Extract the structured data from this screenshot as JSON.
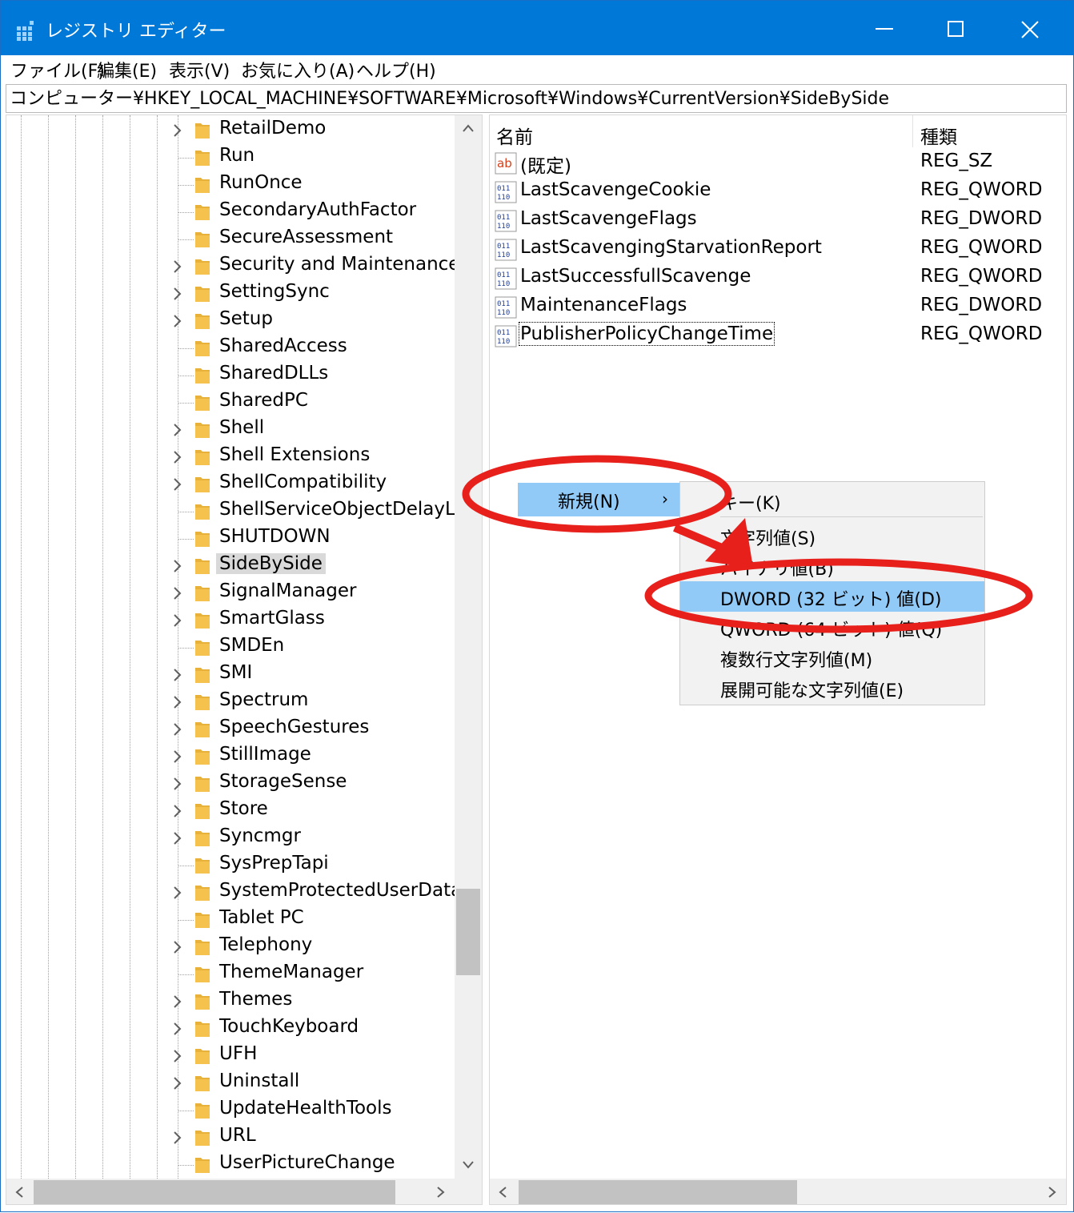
{
  "window": {
    "title": "レジストリ エディター"
  },
  "menu": [
    "ファイル(F)",
    "編集(E)",
    "表示(V)",
    "お気に入り(A)",
    "ヘルプ(H)"
  ],
  "address": "コンピューター¥HKEY_LOCAL_MACHINE¥SOFTWARE¥Microsoft¥Windows¥CurrentVersion¥SideBySide",
  "tree": [
    {
      "label": "RetailDemo",
      "expandable": true
    },
    {
      "label": "Run",
      "expandable": false
    },
    {
      "label": "RunOnce",
      "expandable": false
    },
    {
      "label": "SecondaryAuthFactor",
      "expandable": false
    },
    {
      "label": "SecureAssessment",
      "expandable": false
    },
    {
      "label": "Security and Maintenance",
      "expandable": true
    },
    {
      "label": "SettingSync",
      "expandable": true
    },
    {
      "label": "Setup",
      "expandable": true
    },
    {
      "label": "SharedAccess",
      "expandable": false
    },
    {
      "label": "SharedDLLs",
      "expandable": false
    },
    {
      "label": "SharedPC",
      "expandable": false
    },
    {
      "label": "Shell",
      "expandable": true
    },
    {
      "label": "Shell Extensions",
      "expandable": true
    },
    {
      "label": "ShellCompatibility",
      "expandable": true
    },
    {
      "label": "ShellServiceObjectDelayLoa",
      "expandable": false
    },
    {
      "label": "SHUTDOWN",
      "expandable": false
    },
    {
      "label": "SideBySide",
      "expandable": true,
      "selected": true
    },
    {
      "label": "SignalManager",
      "expandable": true
    },
    {
      "label": "SmartGlass",
      "expandable": true
    },
    {
      "label": "SMDEn",
      "expandable": false
    },
    {
      "label": "SMI",
      "expandable": true
    },
    {
      "label": "Spectrum",
      "expandable": true
    },
    {
      "label": "SpeechGestures",
      "expandable": true
    },
    {
      "label": "StillImage",
      "expandable": true
    },
    {
      "label": "StorageSense",
      "expandable": true
    },
    {
      "label": "Store",
      "expandable": true
    },
    {
      "label": "Syncmgr",
      "expandable": true
    },
    {
      "label": "SysPrepTapi",
      "expandable": false
    },
    {
      "label": "SystemProtectedUserData",
      "expandable": true
    },
    {
      "label": "Tablet PC",
      "expandable": false
    },
    {
      "label": "Telephony",
      "expandable": true
    },
    {
      "label": "ThemeManager",
      "expandable": false
    },
    {
      "label": "Themes",
      "expandable": true
    },
    {
      "label": "TouchKeyboard",
      "expandable": true
    },
    {
      "label": "UFH",
      "expandable": true
    },
    {
      "label": "Uninstall",
      "expandable": true
    },
    {
      "label": "UpdateHealthTools",
      "expandable": false
    },
    {
      "label": "URL",
      "expandable": true
    },
    {
      "label": "UserPictureChange",
      "expandable": false
    }
  ],
  "list": {
    "headers": {
      "name": "名前",
      "type": "種類"
    },
    "rows": [
      {
        "name": "(既定)",
        "type": "REG_SZ",
        "icon": "string-value-icon"
      },
      {
        "name": "LastScavengeCookie",
        "type": "REG_QWORD",
        "icon": "binary-value-icon"
      },
      {
        "name": "LastScavengeFlags",
        "type": "REG_DWORD",
        "icon": "binary-value-icon"
      },
      {
        "name": "LastScavengingStarvationReport",
        "type": "REG_QWORD",
        "icon": "binary-value-icon"
      },
      {
        "name": "LastSuccessfullScavenge",
        "type": "REG_QWORD",
        "icon": "binary-value-icon"
      },
      {
        "name": "MaintenanceFlags",
        "type": "REG_DWORD",
        "icon": "binary-value-icon"
      },
      {
        "name": "PublisherPolicyChangeTime",
        "type": "REG_QWORD",
        "icon": "binary-value-icon",
        "focused": true
      }
    ]
  },
  "context_menu": {
    "new_label": "新規(N)",
    "submenu": [
      "キー(K)",
      "文字列値(S)",
      "バイナリ値(B)",
      "DWORD (32 ビット) 値(D)",
      "QWORD (64 ビット) 値(Q)",
      "複数行文字列値(M)",
      "展開可能な文字列値(E)"
    ],
    "highlighted": "DWORD (32 ビット) 値(D)"
  },
  "colors": {
    "titlebar": "#0078d7",
    "highlight": "#91c9f7",
    "annotation": "#e8201c",
    "folder": "#f4c24d"
  }
}
